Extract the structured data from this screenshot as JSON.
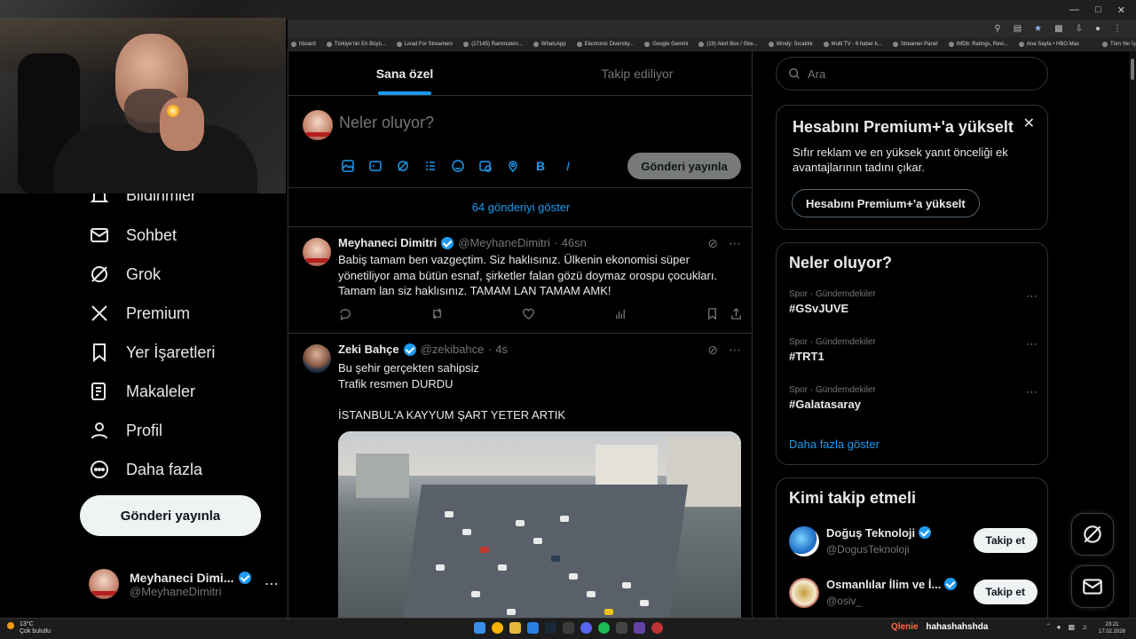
{
  "browser": {
    "bookmarks": [
      "hboard",
      "Türkiye'nin En Büyü...",
      "Livad For Streamers",
      "(17145) Rammstein...",
      "WhatsApp",
      "Electronic Diversity...",
      "Google Gemini",
      "(19) Alert Box / Stre...",
      "Windy: Sıcaklık",
      "Multi TV - 6 haber k...",
      "Streamer Panel",
      "IMDb: Ratings, Revi...",
      "Ana Sayfa • HBO Max",
      "Tüm Yer İşaretleri"
    ]
  },
  "nav": {
    "items": [
      {
        "label": "Bildirimler",
        "icon": "bell-icon"
      },
      {
        "label": "Sohbet",
        "icon": "mail-icon"
      },
      {
        "label": "Grok",
        "icon": "grok-icon"
      },
      {
        "label": "Premium",
        "icon": "x-logo-icon"
      },
      {
        "label": "Yer İşaretleri",
        "icon": "bookmark-icon"
      },
      {
        "label": "Makaleler",
        "icon": "article-icon"
      },
      {
        "label": "Profil",
        "icon": "person-icon"
      },
      {
        "label": "Daha fazla",
        "icon": "more-circle-icon"
      }
    ],
    "post_button": "Gönderi yayınla",
    "account": {
      "name": "Meyhaneci Dimi...",
      "handle": "@MeyhaneDimitri"
    }
  },
  "feed": {
    "tabs": [
      "Sana özel",
      "Takip ediliyor"
    ],
    "composer_placeholder": "Neler oluyor?",
    "composer_post": "Gönderi yayınla",
    "show_posts": "64 gönderiyi göster",
    "tweets": [
      {
        "name": "Meyhaneci Dimitri",
        "handle": "@MeyhaneDimitri",
        "time": "· 46sn",
        "text": "Babiş tamam ben vazgeçtim. Siz haklısınız. Ülkenin ekonomisi süper yönetiliyor ama bütün esnaf, şirketler falan gözü doymaz orospu çocukları. Tamam lan siz haklısınız. TAMAM LAN TAMAM AMK!"
      },
      {
        "name": "Zeki Bahçe",
        "handle": "@zekibahce",
        "time": "· 4s",
        "text": "Bu şehir gerçekten sahipsiz\nTrafik resmen DURDU\n\nİSTANBUL'A KAYYUM ŞART YETER ARTIK"
      }
    ]
  },
  "sidebar": {
    "search_placeholder": "Ara",
    "premium": {
      "title": "Hesabını Premium+'a yükselt",
      "text": "Sıfır reklam ve en yüksek yanıt önceliği ek avantajlarının tadını çıkar.",
      "button": "Hesabını Premium+'a yükselt"
    },
    "trends": {
      "title": "Neler oluyor?",
      "items": [
        {
          "category": "Spor · Gündemdekiler",
          "tag": "#GSvJUVE"
        },
        {
          "category": "Spor · Gündemdekiler",
          "tag": "#TRT1"
        },
        {
          "category": "Spor · Gündemdekiler",
          "tag": "#Galatasaray"
        }
      ],
      "more": "Daha fazla göster"
    },
    "follow": {
      "title": "Kimi takip etmeli",
      "items": [
        {
          "name": "Doğuş Teknoloji",
          "handle": "@DogusTeknoloji",
          "button": "Takip et"
        },
        {
          "name": "Osmanlılar İlim ve İ...",
          "handle": "@osiv_",
          "button": "Takip et"
        }
      ]
    }
  },
  "taskbar": {
    "weather_temp": "13°C",
    "weather_desc": "Çok bulutlu",
    "chat_user": "Qlenie",
    "chat_message": "hahashahshda",
    "time": "23:21",
    "date": "17.02.2026"
  },
  "colors": {
    "accent": "#1d9bf0",
    "background": "#000000",
    "border": "#2f3336",
    "muted": "#71767b"
  }
}
